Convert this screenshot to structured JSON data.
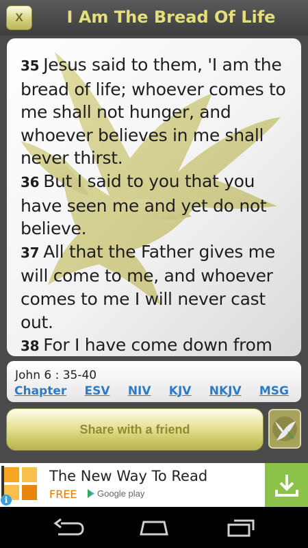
{
  "header": {
    "close_label": "X",
    "title": "I Am The Bread Of Life"
  },
  "passage": {
    "verses": [
      {
        "num": "35",
        "text": "Jesus said to them, 'I am the bread of life; whoever comes to me shall not hunger, and whoever believes in me shall never thirst."
      },
      {
        "num": "36",
        "text": "But I said to you that you have seen me and yet do not believe."
      },
      {
        "num": "37",
        "text": "All that the Father gives me will come to me, and whoever comes to me I will never cast out."
      },
      {
        "num": "38",
        "text": "For I have come down from"
      }
    ]
  },
  "reference": {
    "label": "John 6 : 35-40",
    "links": [
      "Chapter",
      "ESV",
      "NIV",
      "KJV",
      "NKJV",
      "MSG"
    ]
  },
  "share": {
    "label": "Share with a friend"
  },
  "ad": {
    "headline": "The New Way To Read",
    "price": "FREE",
    "store": "Google play",
    "info": "i"
  },
  "colors": {
    "title_gold": "#e4df7a",
    "link_blue": "#2b7bc8",
    "download_green": "#8bc34a",
    "ad_orange": "#e07b00"
  },
  "icons": [
    "close-icon",
    "dove-watermark",
    "dove-icon",
    "app-logo-icon",
    "download-icon",
    "google-play-icon",
    "info-icon",
    "back-icon",
    "home-icon",
    "recent-apps-icon"
  ]
}
